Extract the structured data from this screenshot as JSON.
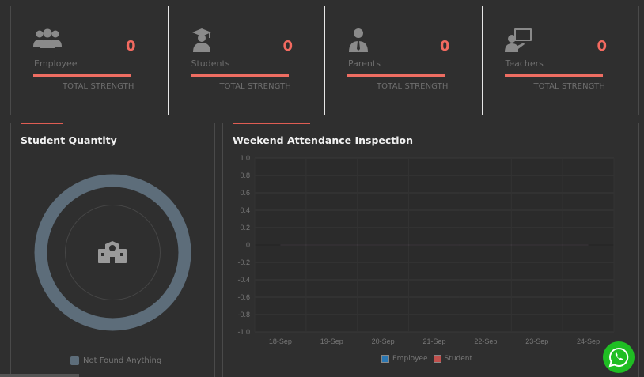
{
  "stats": [
    {
      "label": "Employee",
      "value": "0",
      "sub": "TOTAL STRENGTH",
      "icon": "users-icon"
    },
    {
      "label": "Students",
      "value": "0",
      "sub": "TOTAL STRENGTH",
      "icon": "graduate-icon"
    },
    {
      "label": "Parents",
      "value": "0",
      "sub": "TOTAL STRENGTH",
      "icon": "user-tie-icon"
    },
    {
      "label": "Teachers",
      "value": "0",
      "sub": "TOTAL STRENGTH",
      "icon": "teacher-board-icon"
    }
  ],
  "student_quantity": {
    "title": "Student Quantity",
    "legend": "Not Found Anything",
    "icon": "school-icon",
    "ring_color": "#5d6d7a"
  },
  "attendance": {
    "title": "Weekend Attendance Inspection",
    "legend": [
      {
        "name": "Employee",
        "color": "#2b78b4"
      },
      {
        "name": "Student",
        "color": "#c0504d"
      }
    ]
  },
  "chart_data": {
    "type": "line",
    "categories": [
      "18-Sep",
      "19-Sep",
      "20-Sep",
      "21-Sep",
      "22-Sep",
      "23-Sep",
      "24-Sep"
    ],
    "series": [
      {
        "name": "Employee",
        "values": [
          0,
          0,
          0,
          0,
          0,
          0,
          0
        ]
      },
      {
        "name": "Student",
        "values": [
          0,
          0,
          0,
          0,
          0,
          0,
          0
        ]
      }
    ],
    "yticks": [
      "1.0",
      "0.8",
      "0.6",
      "0.4",
      "0.2",
      "0",
      "-0.2",
      "-0.4",
      "-0.6",
      "-0.8",
      "-1.0"
    ],
    "ylim": [
      -1.0,
      1.0
    ],
    "grid": true,
    "legend_position": "bottom"
  },
  "colors": {
    "accent": "#ee6d62",
    "value": "#f36a60",
    "whatsapp": "#1fbe23"
  }
}
